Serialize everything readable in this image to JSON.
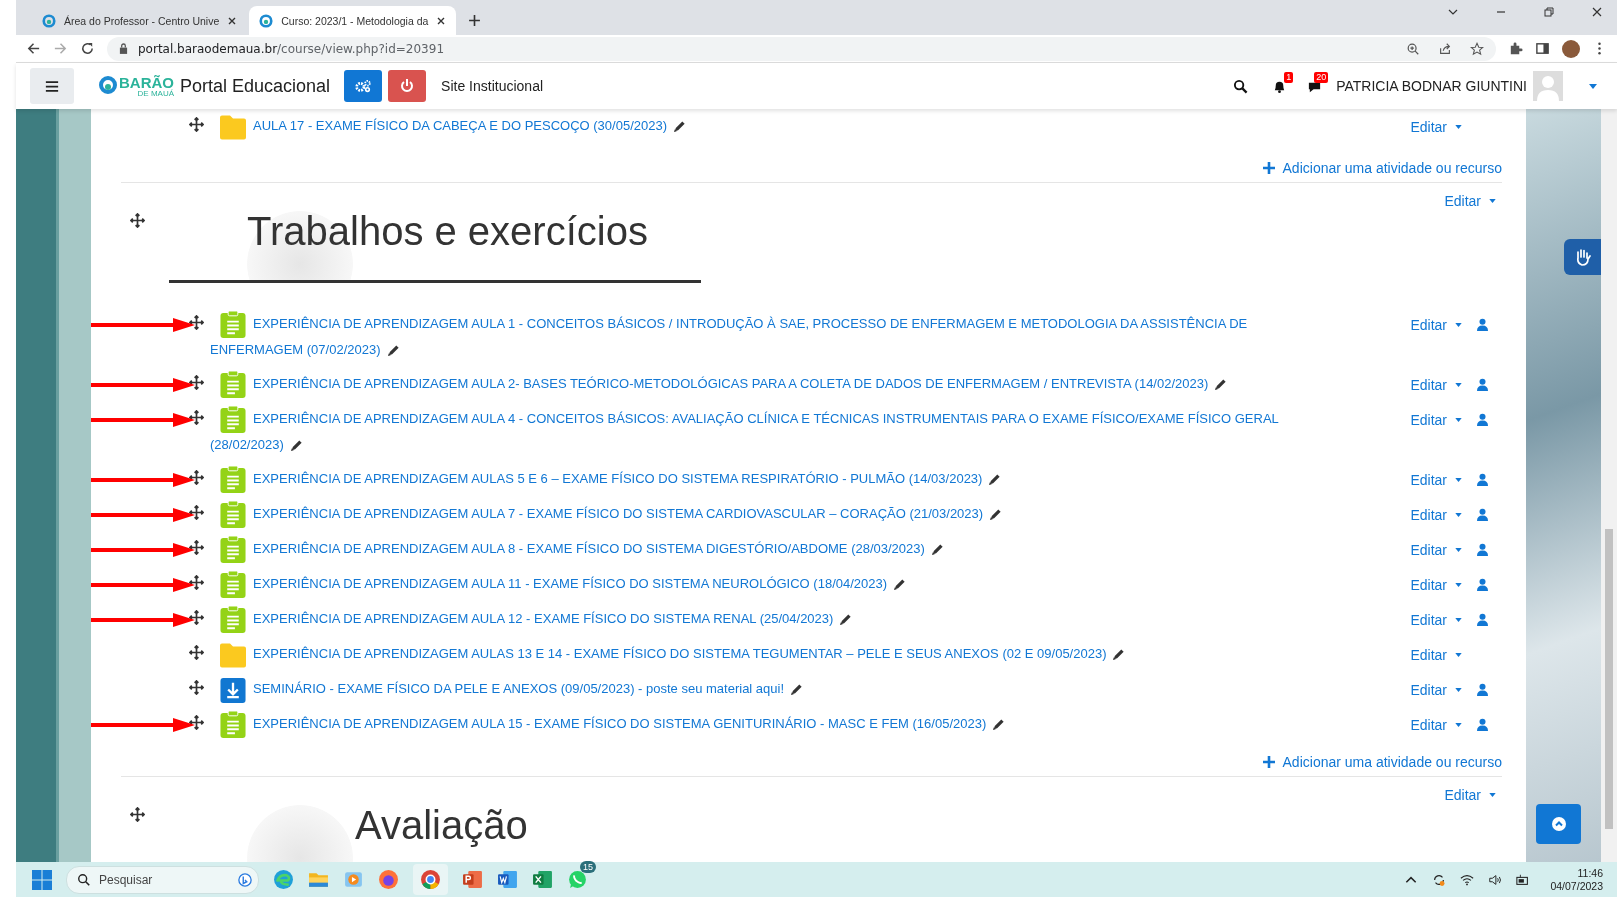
{
  "browser": {
    "tabs": [
      {
        "title": "Área do Professor - Centro Unive",
        "selected": false
      },
      {
        "title": "Curso: 2023/1 - Metodologia da",
        "selected": true
      }
    ],
    "url_host": "portal.baraodemaua.br",
    "url_path": "/course/view.php?id=20391"
  },
  "navbar": {
    "logo_text": "BARÃO",
    "logo_sub": "DE MAUÁ",
    "portal_title": "Portal Educacional",
    "site_link": "Site Institucional",
    "notifications": "1",
    "messages": "20",
    "user_name": "PATRICIA BODNAR GIUNTINI"
  },
  "sections": [
    {
      "add_activity": "Adicionar uma atividade ou recurso",
      "items": [
        {
          "kind": "folder",
          "title": "AULA 17 - EXAME FÍSICO DA CABEÇA E DO PESCOÇO (30/05/2023)",
          "edit": "Editar",
          "user_icon": false,
          "arrow": false
        }
      ]
    },
    {
      "title": "Trabalhos e exercícios",
      "edit": "Editar",
      "add_activity": "Adicionar uma atividade ou recurso",
      "items": [
        {
          "kind": "assignment",
          "title": "EXPERIÊNCIA DE APRENDIZAGEM AULA 1 - CONCEITOS BÁSICOS / INTRODUÇÃO À SAE, PROCESSO DE ENFERMAGEM E METODOLOGIA DA ASSISTÊNCIA DE ENFERMAGEM (07/02/2023)",
          "edit": "Editar",
          "user_icon": true,
          "arrow": true
        },
        {
          "kind": "assignment",
          "title": "EXPERIÊNCIA DE APRENDIZAGEM AULA 2- BASES TEÓRICO-METODOLÓGICAS PARA A COLETA DE DADOS DE ENFERMAGEM / ENTREVISTA (14/02/2023)",
          "edit": "Editar",
          "user_icon": true,
          "arrow": true
        },
        {
          "kind": "assignment",
          "title": "EXPERIÊNCIA DE APRENDIZAGEM AULA 4 - CONCEITOS BÁSICOS: AVALIAÇÃO CLÍNICA E TÉCNICAS INSTRUMENTAIS PARA O EXAME FÍSICO/EXAME FÍSICO GERAL (28/02/2023)",
          "edit": "Editar",
          "user_icon": true,
          "arrow": true
        },
        {
          "kind": "assignment",
          "title": "EXPERIÊNCIA DE APRENDIZAGEM AULAS 5 E 6 – EXAME FÍSICO DO SISTEMA RESPIRATÓRIO - PULMÃO (14/03/2023)",
          "edit": "Editar",
          "user_icon": true,
          "arrow": true
        },
        {
          "kind": "assignment",
          "title": "EXPERIÊNCIA DE APRENDIZAGEM AULA 7 - EXAME FÍSICO DO SISTEMA CARDIOVASCULAR – CORAÇÃO (21/03/2023)",
          "edit": "Editar",
          "user_icon": true,
          "arrow": true
        },
        {
          "kind": "assignment",
          "title": "EXPERIÊNCIA DE APRENDIZAGEM AULA 8 - EXAME FÍSICO DO SISTEMA DIGESTÓRIO/ABDOME (28/03/2023)",
          "edit": "Editar",
          "user_icon": true,
          "arrow": true
        },
        {
          "kind": "assignment",
          "title": "EXPERIÊNCIA DE APRENDIZAGEM AULA 11 - EXAME FÍSICO DO SISTEMA NEUROLÓGICO (18/04/2023)",
          "edit": "Editar",
          "user_icon": true,
          "arrow": true
        },
        {
          "kind": "assignment",
          "title": "EXPERIÊNCIA DE APRENDIZAGEM AULA 12 - EXAME FÍSICO DO SISTEMA RENAL (25/04/2023)",
          "edit": "Editar",
          "user_icon": true,
          "arrow": true
        },
        {
          "kind": "folder",
          "title": "EXPERIÊNCIA DE APRENDIZAGEM AULAS 13 E 14 - EXAME FÍSICO DO SISTEMA TEGUMENTAR – PELE E SEUS ANEXOS (02 E 09/05/2023)",
          "edit": "Editar",
          "user_icon": false,
          "arrow": false
        },
        {
          "kind": "upload",
          "title": "SEMINÁRIO - EXAME FÍSICO DA PELE E ANEXOS (09/05/2023) - poste seu material aqui!",
          "edit": "Editar",
          "user_icon": true,
          "arrow": false
        },
        {
          "kind": "assignment",
          "title": "EXPERIÊNCIA DE APRENDIZAGEM AULA 15 - EXAME FÍSICO DO SISTEMA GENITURINÁRIO - MASC E FEM (16/05/2023)",
          "edit": "Editar",
          "user_icon": true,
          "arrow": true
        }
      ]
    },
    {
      "title": "Avaliação",
      "edit": "Editar"
    }
  ],
  "taskbar": {
    "search_placeholder": "Pesquisar",
    "whatsapp_badge": "15",
    "time": "11:46",
    "date": "04/07/2023"
  }
}
